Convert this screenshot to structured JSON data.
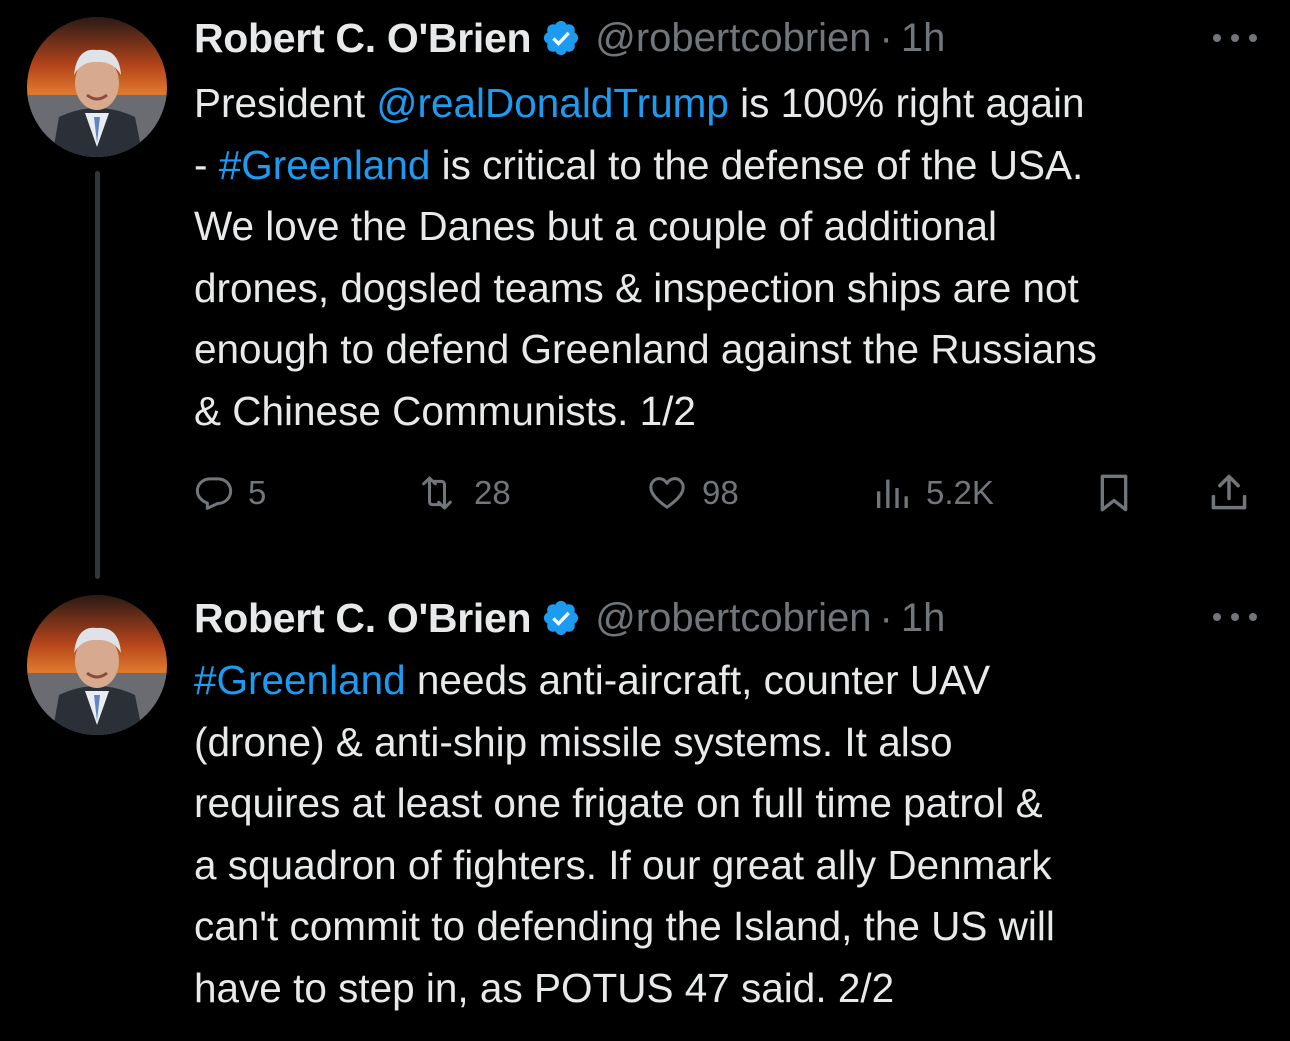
{
  "tweets": [
    {
      "author_name": "Robert C. O'Brien",
      "handle": "@robertcobrien",
      "separator": "·",
      "time": "1h",
      "body_lines": [
        [
          {
            "text": "President "
          },
          {
            "text": "@realDonaldTrump",
            "link": true
          },
          {
            "text": " is 100% right again"
          }
        ],
        [
          {
            "text": "- "
          },
          {
            "text": "#Greenland",
            "link": true
          },
          {
            "text": " is critical to the defense of the USA."
          }
        ],
        [
          {
            "text": "We love the Danes but a couple of additional"
          }
        ],
        [
          {
            "text": "drones, dogsled teams & inspection ships are not"
          }
        ],
        [
          {
            "text": "enough to defend Greenland against the Russians"
          }
        ],
        [
          {
            "text": "& Chinese Communists. 1/2"
          }
        ]
      ],
      "actions": {
        "replies": "5",
        "reposts": "28",
        "likes": "98",
        "views": "5.2K"
      }
    },
    {
      "author_name": "Robert C. O'Brien",
      "handle": "@robertcobrien",
      "separator": "·",
      "time": "1h",
      "body_lines": [
        [
          {
            "text": "#Greenland",
            "link": true
          },
          {
            "text": " needs anti-aircraft, counter UAV"
          }
        ],
        [
          {
            "text": "(drone) & anti-ship missile systems. It also"
          }
        ],
        [
          {
            "text": "requires at least one frigate on full time patrol &"
          }
        ],
        [
          {
            "text": "a squadron of fighters. If our great ally Denmark"
          }
        ],
        [
          {
            "text": "can't commit to defending the Island, the US will"
          }
        ],
        [
          {
            "text": "have to step in, as POTUS 47 said.  2/2"
          }
        ]
      ]
    }
  ],
  "colors": {
    "background": "#000000",
    "text": "#e7e9ea",
    "muted": "#71767b",
    "link": "#1d9bf0",
    "verified": "#1d9bf0"
  },
  "icons": {
    "verified": "verified-badge-icon",
    "more": "more-dots-icon",
    "reply": "reply-icon",
    "repost": "repost-icon",
    "like": "heart-icon",
    "views": "views-chart-icon",
    "bookmark": "bookmark-icon",
    "share": "share-icon"
  }
}
